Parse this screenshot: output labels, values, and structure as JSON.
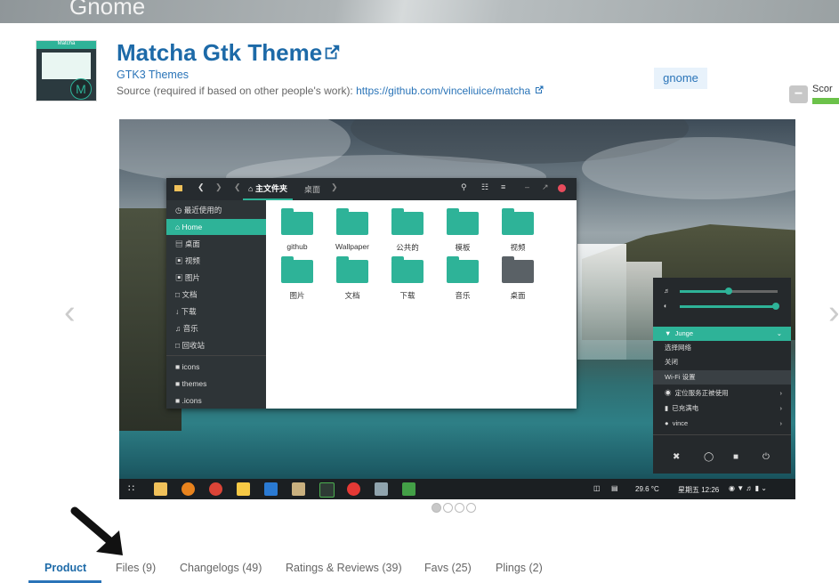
{
  "banner": {
    "text": "Gnome"
  },
  "product": {
    "logo_label": "Matcha",
    "logo_letter": "M",
    "title": "Matcha Gtk Theme",
    "category": "GTK3 Themes",
    "source_prefix": "Source (required if based on other people's work): ",
    "source_link": "https://github.com/vinceliuice/matcha",
    "tag": "gnome",
    "score_label": "Scor",
    "minus_label": "−"
  },
  "gallery": {
    "prev": "‹",
    "next": "›",
    "dot_count": 4,
    "active_dot": 0
  },
  "file_manager": {
    "path_home": "主文件夹",
    "path_desktop": "桌面",
    "sidebar": [
      {
        "label": "最近使用的",
        "icon": "clock-icon"
      },
      {
        "label": "Home",
        "icon": "home-icon"
      },
      {
        "label": "桌面",
        "icon": "desktop-icon"
      },
      {
        "label": "视频",
        "icon": "video-icon"
      },
      {
        "label": "图片",
        "icon": "image-icon"
      },
      {
        "label": "文档",
        "icon": "document-icon"
      },
      {
        "label": "下载",
        "icon": "download-icon"
      },
      {
        "label": "音乐",
        "icon": "music-icon"
      },
      {
        "label": "回收站",
        "icon": "trash-icon"
      },
      {
        "label": "icons",
        "icon": "folder-icon"
      },
      {
        "label": "themes",
        "icon": "folder-icon"
      },
      {
        "label": ".icons",
        "icon": "folder-icon"
      }
    ],
    "folders": [
      "github",
      "Wallpaper",
      "公共的",
      "模板",
      "视频",
      "图片",
      "文档",
      "下载",
      "音乐",
      "桌面"
    ]
  },
  "system_menu": {
    "wifi_name": "Junge",
    "select_network": "选择网络",
    "close": "关闭",
    "wifi_settings": "Wi-Fi 设置",
    "location": "定位服务正被使用",
    "battery": "已充满电",
    "user": "vince"
  },
  "taskbar": {
    "temperature": "29.6 °C",
    "clock": "星期五 12:26"
  },
  "tabs": [
    {
      "label": "Product"
    },
    {
      "label": "Files (9)"
    },
    {
      "label": "Changelogs (49)"
    },
    {
      "label": "Ratings & Reviews (39)"
    },
    {
      "label": "Favs (25)"
    },
    {
      "label": "Plings (2)"
    }
  ]
}
